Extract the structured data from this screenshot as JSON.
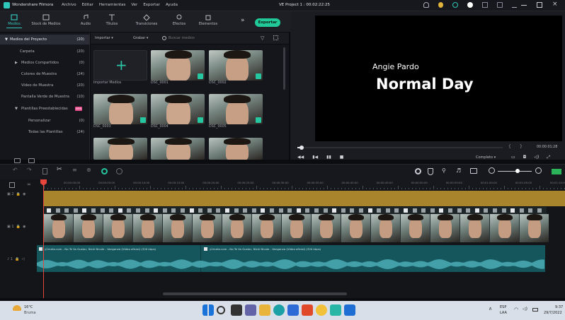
{
  "app": {
    "name": "Wondershare Filmora",
    "menu": [
      "Archivo",
      "Editar",
      "Herramientas",
      "Ver",
      "Exportar",
      "Ayuda"
    ],
    "project_title": "VE Project 1 : 00:02:22:25"
  },
  "toolbar": {
    "tabs": [
      {
        "label": "Medios",
        "icon": "media-icon",
        "active": true
      },
      {
        "label": "Stock de Medios",
        "icon": "stock-media-icon"
      },
      {
        "label": "Audio",
        "icon": "audio-icon"
      },
      {
        "label": "Títulos",
        "icon": "titles-icon"
      },
      {
        "label": "Transiciones",
        "icon": "transitions-icon"
      },
      {
        "label": "Efectos",
        "icon": "effects-icon"
      },
      {
        "label": "Elementos",
        "icon": "elements-icon"
      }
    ],
    "more": "»",
    "export_label": "Exportar"
  },
  "sidebar": {
    "items": [
      {
        "label": "Medios del Proyecto",
        "count": "(20)",
        "selected": true,
        "arrow": "▼"
      },
      {
        "label": "Carpeta",
        "count": "(20)"
      },
      {
        "label": "Medios Compartidos",
        "count": "(0)",
        "arrow": "▶"
      },
      {
        "label": "Colores de Muestra",
        "count": "(24)"
      },
      {
        "label": "Video de Muestra",
        "count": "(20)"
      },
      {
        "label": "Pantalla Verde de Muestra",
        "count": "(10)"
      },
      {
        "label": "Plantillas Preestablecidas",
        "count": "",
        "arrow": "▼",
        "badge": "NEW"
      },
      {
        "label": "Personalizar",
        "count": "(0)"
      },
      {
        "label": "Todas las Plantillas",
        "count": "(24)"
      }
    ]
  },
  "filterbar": {
    "import_label": "Importar",
    "record_label": "Grabar",
    "search_placeholder": "Buscar medios"
  },
  "media": {
    "import_label": "Importar Medios",
    "clips": [
      "DSC_0001",
      "DSC_0002",
      "DSC_0003",
      "DSC_0004",
      "DSC_0005"
    ]
  },
  "preview": {
    "overlay_name": "Angie Pardo",
    "overlay_title": "Normal Day",
    "timecode": "00:00:01:28",
    "quality": "Completo",
    "progress": 0.02
  },
  "timeline": {
    "ruler_ticks": [
      "00:00:00:00",
      "00:00:05:00",
      "00:00:10:00",
      "00:00:15:00",
      "00:00:20:00",
      "00:00:25:00",
      "00:00:30:00",
      "00:00:35:00",
      "00:00:40:00",
      "00:00:45:00",
      "00:00:50:00",
      "00:00:55:00",
      "00:01:00:00",
      "00:01:05:00",
      "00:01:10:00"
    ],
    "audio_clip_1": "y2meta.com - No Te Va Gustar, Nicki Nicole - Venganza (Video oficial) (320 kbps)",
    "audio_clip_2": "y2meta.com - No Te Va Gustar, Nicki Nicole - Venganza (Video oficial) (320 kbps)"
  },
  "taskbar": {
    "weather_temp": "16°C",
    "weather_desc": "Bruma",
    "lang": "ESP",
    "lang2": "LAA",
    "time": "9:37",
    "date": "29/7/2022"
  },
  "colors": {
    "accent": "#20c997",
    "video_track": "#273033",
    "audio_track": "#15565d",
    "overlay_track": "#a8842d",
    "playhead": "#e8453c"
  }
}
